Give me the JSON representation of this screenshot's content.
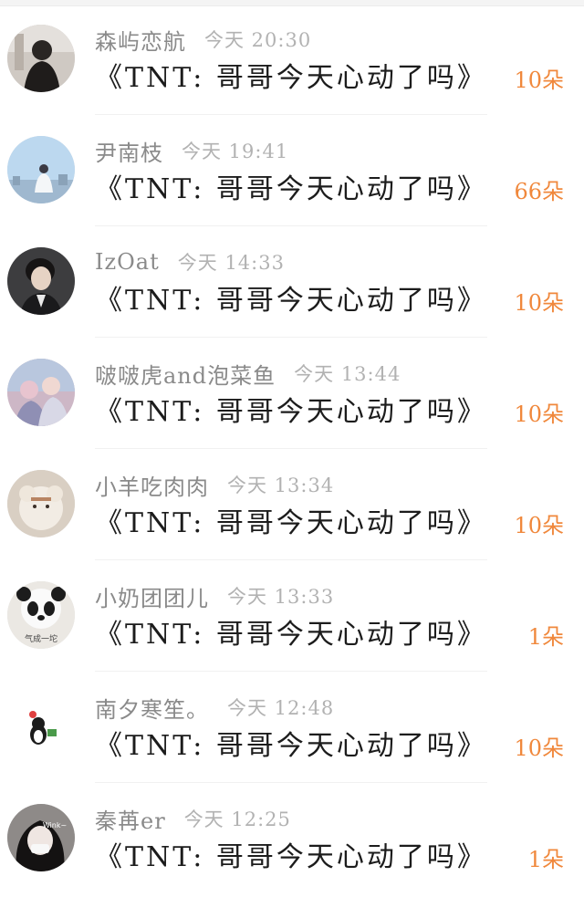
{
  "gift_list": [
    {
      "username": "森屿恋航",
      "time": "今天 20:30",
      "title": "《TNT: 哥哥今天心动了吗》",
      "flowers": "10朵"
    },
    {
      "username": "尹南枝",
      "time": "今天 19:41",
      "title": "《TNT: 哥哥今天心动了吗》",
      "flowers": "66朵"
    },
    {
      "username": "IzOat",
      "time": "今天 14:33",
      "title": "《TNT: 哥哥今天心动了吗》",
      "flowers": "10朵"
    },
    {
      "username": "啵啵虎and泡菜鱼",
      "time": "今天 13:44",
      "title": "《TNT: 哥哥今天心动了吗》",
      "flowers": "10朵"
    },
    {
      "username": "小羊吃肉肉",
      "time": "今天 13:34",
      "title": "《TNT: 哥哥今天心动了吗》",
      "flowers": "10朵"
    },
    {
      "username": "小奶团团儿",
      "time": "今天 13:33",
      "title": "《TNT: 哥哥今天心动了吗》",
      "flowers": "1朵"
    },
    {
      "username": "南夕寒笙。",
      "time": "今天 12:48",
      "title": "《TNT: 哥哥今天心动了吗》",
      "flowers": "10朵"
    },
    {
      "username": "秦苒er",
      "time": "今天 12:25",
      "title": "《TNT: 哥哥今天心动了吗》",
      "flowers": "1朵"
    }
  ],
  "avatar_texts": {
    "panda": "气成一坨",
    "girl": "Wink~"
  },
  "colors": {
    "username": "#8a8a8a",
    "timestamp": "#b2b2b2",
    "title": "#1c1c1c",
    "flowers": "#f0883c"
  }
}
